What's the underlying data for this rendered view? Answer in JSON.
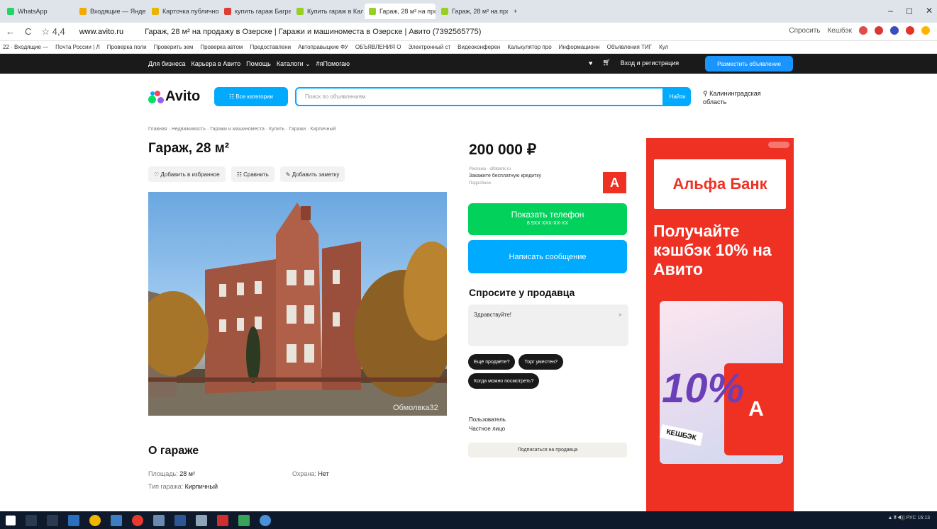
{
  "browser": {
    "tabs": [
      {
        "label": "WhatsApp",
        "color": "#25d366"
      },
      {
        "label": "Входящие — Яндекс",
        "color": "#f2a900"
      },
      {
        "label": "Карточка публичной",
        "color": "#e9b500"
      },
      {
        "label": "купить гараж Багратион",
        "color": "#e03c31"
      },
      {
        "label": "Купить гараж в Калинин",
        "color": "#97cf26"
      },
      {
        "label": "Гараж, 28 м² на продаж",
        "color": "#97cf26",
        "active": true
      },
      {
        "label": "Гараж, 28 м² на продаж",
        "color": "#97cf26"
      }
    ],
    "new_tab": "+",
    "address": {
      "back": "←",
      "reload": "C",
      "rating": "☆ 4,4",
      "url": "www.avito.ru",
      "page_title": "Гараж, 28 м² на продажу в Озерске | Гаражи и машиноместа в Озерске | Авито (7392565775)",
      "ext_labels": [
        "Спросить",
        "Кешбэк"
      ]
    },
    "bookmarks": [
      "22 · Входящие —",
      "Почта России | Л",
      "Проверка поли",
      "Проверить зем",
      "Проверка автом",
      "Предоставлени",
      "Автоправыцкие ФУ",
      "ОБЪЯВЛЕНИЯ О",
      "Электронный ст",
      "Видеоконферен",
      "Калькулятор про",
      "Информационн",
      "Объявления ТИГ",
      "Кул"
    ]
  },
  "topnav": {
    "links": [
      "Для бизнеса",
      "Карьера в Авито",
      "Помощь",
      "Каталоги ⌄",
      "#яПомогаю"
    ],
    "login": "Вход и регистрация",
    "post_button": "Разместить объявление"
  },
  "header": {
    "logo": "Avito",
    "categories_button": "☷ Все категории",
    "search_placeholder": "Поиск по объявлениям",
    "search_button": "Найти",
    "region": "Калининградская область"
  },
  "listing": {
    "breadcrumbs": "Главная · Недвижимость · Гаражи и машиноместа · Купить · Гаражи · Кирпичный",
    "title": "Гараж, 28 м²",
    "actions": [
      "♡ Добавить в избранное",
      "☷ Сравнить",
      "✎ Добавить заметку"
    ],
    "photo_watermark": "Обмолвка32",
    "about_title": "О гараже",
    "params": [
      {
        "label": "Площадь:",
        "value": "28 м²"
      },
      {
        "label": "Тип гаража:",
        "value": "Кирпичный"
      }
    ],
    "params2": [
      {
        "label": "Охрана:",
        "value": "Нет"
      }
    ],
    "price": "200 000 ₽",
    "credit_small": "Реклама · alfabank.ru",
    "credit_text": "Закажите бесплатную кредитку",
    "credit_more": "Подробнее",
    "alfa_letter": "А",
    "phone_button": "Показать телефон",
    "phone_mask": "8 9ХХ ХХХ-ХХ-ХХ",
    "message_button": "Написать сообщение",
    "ask_title": "Спросите у продавца",
    "ask_placeholder": "Здравствуйте!",
    "ask_send": "➤",
    "chips": [
      "Ещё продаёте?",
      "Торг уместен?",
      "Когда можно посмотреть?"
    ],
    "seller_role": "Пользователь",
    "seller_type": "Частное лицо",
    "subscribe_button": "Подписаться на продавца"
  },
  "ad": {
    "bank": "Альфа Банк",
    "headline": "Получайте кэшбэк 10% на Авито",
    "big_percent": "10%",
    "cashback_label": "КЕШБЭК",
    "card_letter": "А"
  },
  "taskbar": {
    "tray": "▲ 𝄝 ◀)) РУС 16:13"
  }
}
